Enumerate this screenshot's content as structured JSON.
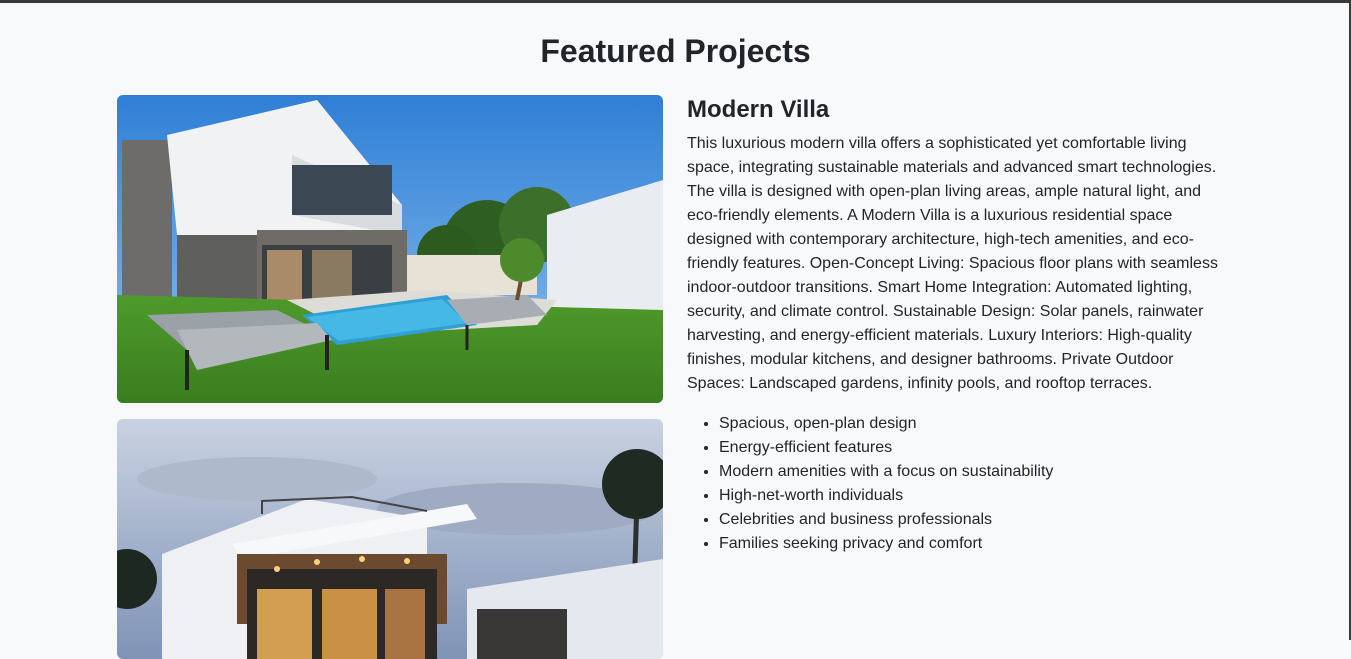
{
  "section": {
    "title": "Featured Projects"
  },
  "project": {
    "name": "Modern Villa",
    "description": "This luxurious modern villa offers a sophisticated yet comfortable living space, integrating sustainable materials and advanced smart technologies. The villa is designed with open-plan living areas, ample natural light, and eco-friendly elements. A Modern Villa is a luxurious residential space designed with contemporary architecture, high-tech amenities, and eco-friendly features. Open-Concept Living: Spacious floor plans with seamless indoor-outdoor transitions. Smart Home Integration: Automated lighting, security, and climate control. Sustainable Design: Solar panels, rainwater harvesting, and energy-efficient materials. Luxury Interiors: High-quality finishes, modular kitchens, and designer bathrooms. Private Outdoor Spaces: Landscaped gardens, infinity pools, and rooftop terraces.",
    "features": [
      "Spacious, open-plan design",
      "Energy-efficient features",
      "Modern amenities with a focus on sustainability",
      "High-net-worth individuals",
      "Celebrities and business professionals",
      "Families seeking privacy and comfort"
    ]
  },
  "colors": {
    "background": "#f8f9fb",
    "text": "#212529",
    "border": "#3a3a3a"
  }
}
